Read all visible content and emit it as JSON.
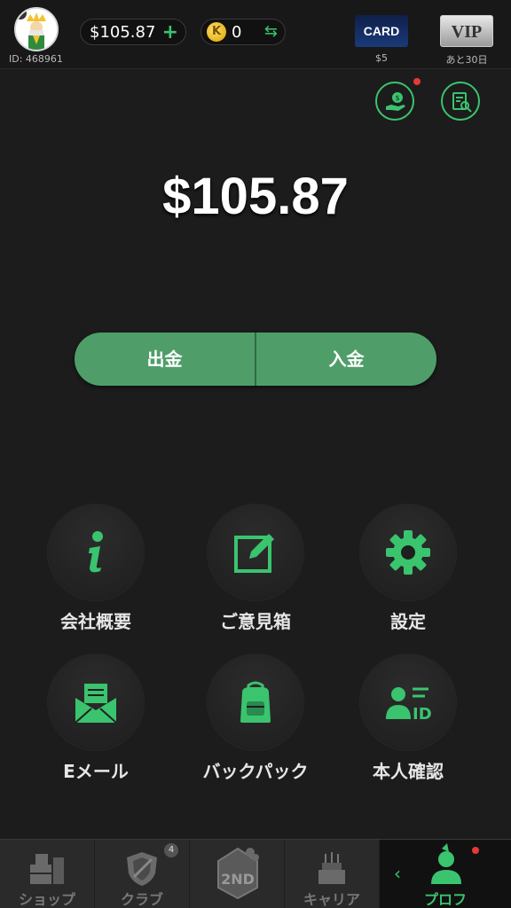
{
  "header": {
    "user_id": "ID: 468961",
    "avatar_badge": "V",
    "balance": "$105.87",
    "balance_add": "+",
    "coin_letter": "K",
    "coins": "0",
    "swap_icon": "⇆",
    "card_label": "CARD",
    "card_price": "$5",
    "vip_label": "VIP",
    "vip_remaining": "あと30日"
  },
  "main": {
    "balance": "$105.87",
    "withdraw_label": "出金",
    "deposit_label": "入金"
  },
  "features": [
    {
      "label": "会社概要",
      "icon": "info-icon"
    },
    {
      "label": "ご意見箱",
      "icon": "edit-icon"
    },
    {
      "label": "設定",
      "icon": "gear-icon"
    },
    {
      "label": "Eメール",
      "icon": "mail-icon"
    },
    {
      "label": "バックパック",
      "icon": "backpack-icon"
    },
    {
      "label": "本人確認",
      "icon": "id-card-icon"
    }
  ],
  "bottom_nav": [
    {
      "label": "ショップ",
      "icon": "shop-icon"
    },
    {
      "label": "クラブ",
      "icon": "club-shield-icon",
      "badge": "4"
    },
    {
      "label": "",
      "icon": "2nd-place-icon"
    },
    {
      "label": "キャリア",
      "icon": "career-cake-icon"
    },
    {
      "label": "プロフ",
      "icon": "profile-icon",
      "active": true
    }
  ],
  "colors": {
    "accent": "#3ac46e",
    "button": "#4f9e6a",
    "background": "#1c1c1c",
    "notification": "#e53935"
  }
}
